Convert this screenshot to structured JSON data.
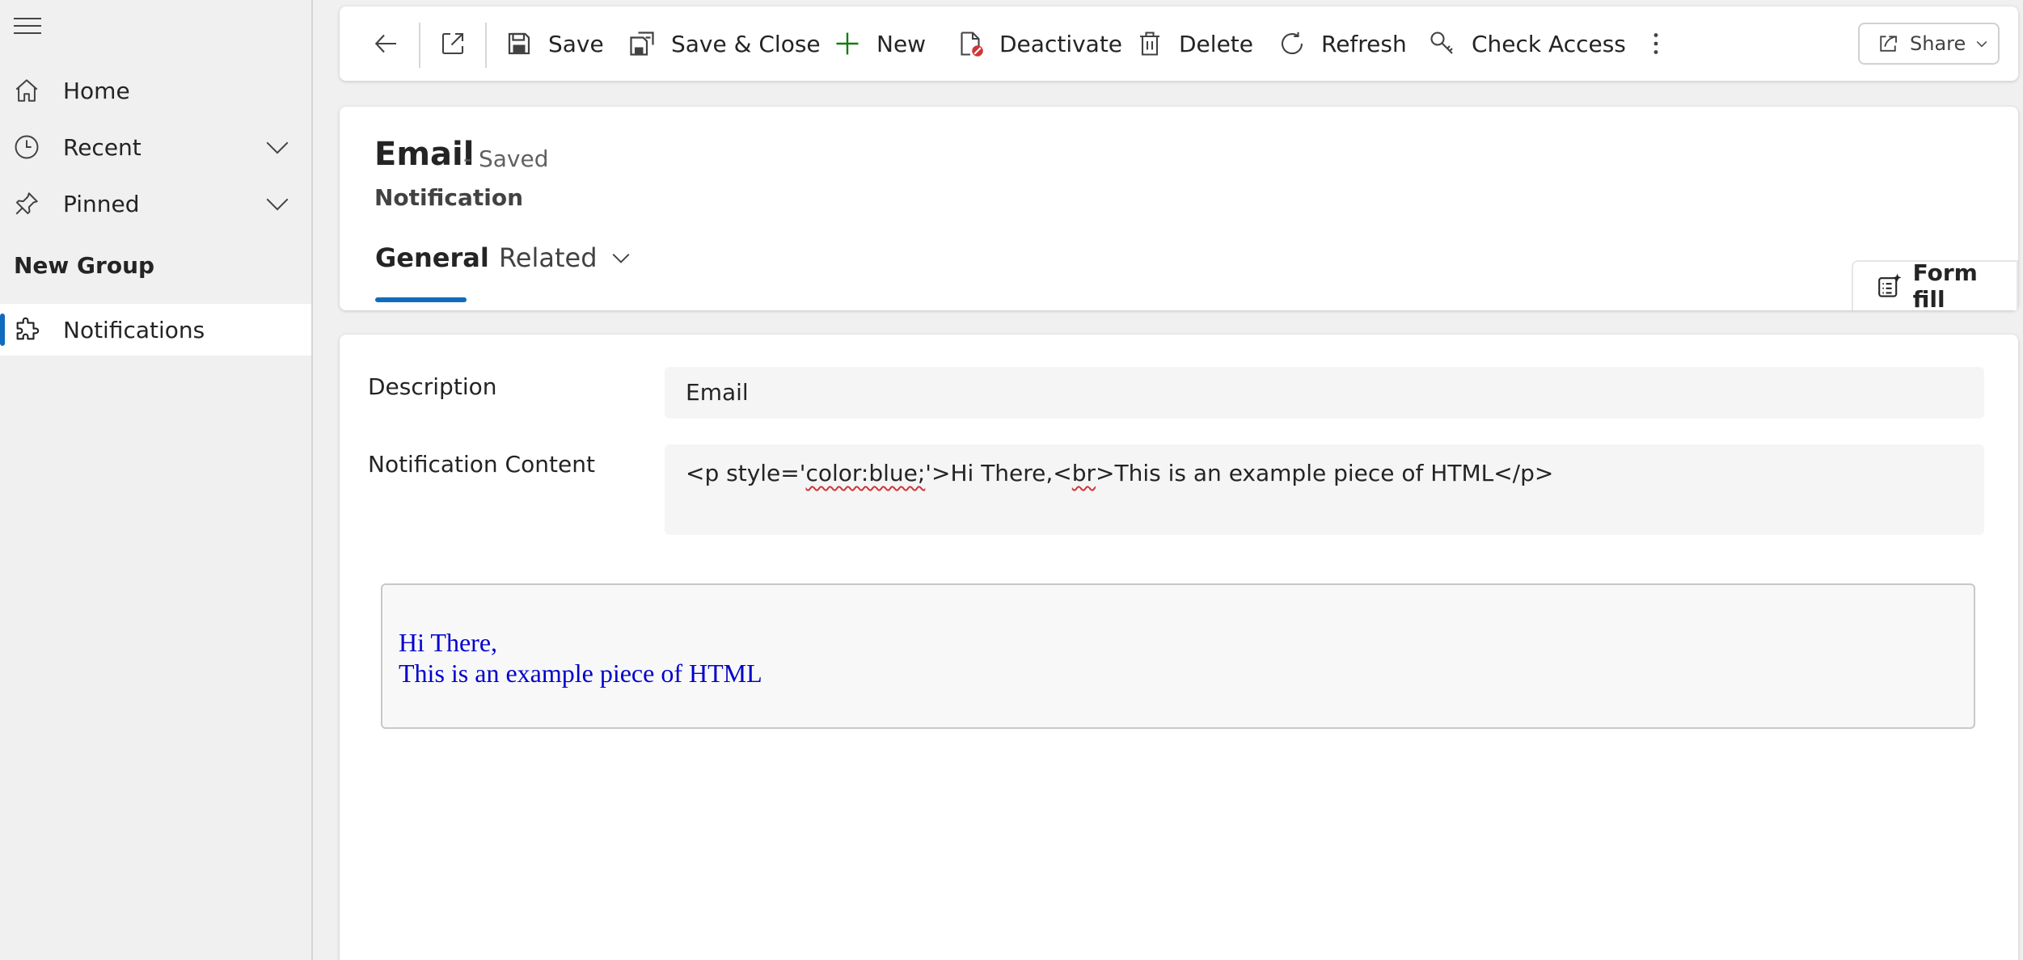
{
  "sidebar": {
    "items": [
      {
        "label": "Home",
        "icon": "home-icon"
      },
      {
        "label": "Recent",
        "icon": "clock-icon"
      },
      {
        "label": "Pinned",
        "icon": "pin-icon"
      }
    ],
    "group_title": "New Group",
    "group_items": [
      {
        "label": "Notifications",
        "icon": "puzzle-icon",
        "active": true
      }
    ]
  },
  "toolbar": {
    "save": "Save",
    "save_close": "Save & Close",
    "new": "New",
    "deactivate": "Deactivate",
    "delete": "Delete",
    "refresh": "Refresh",
    "check_access": "Check Access",
    "share": "Share"
  },
  "record": {
    "title": "Email",
    "status": "- Saved",
    "entity": "Notification"
  },
  "tabs": {
    "general": "General",
    "related": "Related"
  },
  "form_fill": "Form fill",
  "fields": {
    "description": {
      "label": "Description",
      "value": "Email"
    },
    "notification_content": {
      "label": "Notification Content",
      "value_pre": "<p style='",
      "value_err1": "color:blue;",
      "value_mid": "'>Hi There,<",
      "value_err2": "br",
      "value_post": ">This is an example piece of HTML</p>"
    }
  },
  "preview": {
    "line1": "Hi There,",
    "line2": "This is an example piece of HTML",
    "text_color": "#0000cc"
  },
  "colors": {
    "accent": "#0f6cbd",
    "new_icon": "#107c10",
    "deactivate_badge": "#d13438"
  }
}
